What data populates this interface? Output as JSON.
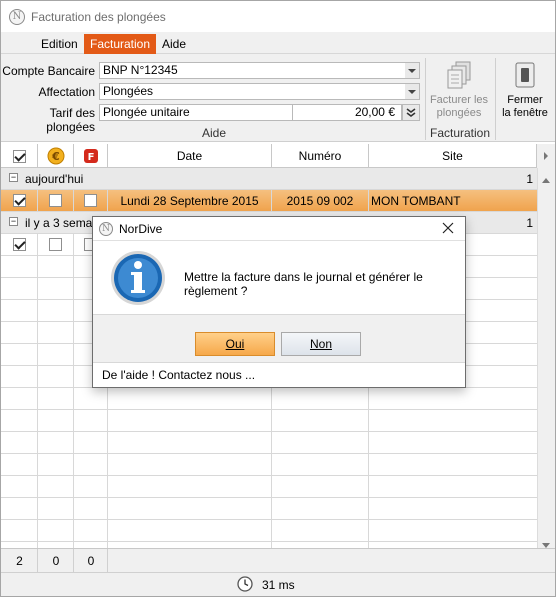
{
  "window": {
    "title": "Facturation des plongées"
  },
  "ribbon_tabs": [
    "Edition",
    "Facturation",
    "Aide"
  ],
  "ribbon": {
    "compte_label": "Compte Bancaire",
    "compte_value": "BNP N°12345",
    "affectation_label": "Affectation",
    "affectation_value": "Plongées",
    "tarif_label": "Tarif des plongées",
    "tarif_value": "Plongée unitaire",
    "tarif_amount": "20,00 €",
    "group_aide": "Aide",
    "group_facturation": "Facturation",
    "facturer_line1": "Facturer les",
    "facturer_line2": "plongées",
    "fermer_line1": "Fermer",
    "fermer_line2": "la fenêtre"
  },
  "grid": {
    "columns": {
      "date": "Date",
      "numero": "Numéro",
      "site": "Site"
    },
    "groups": [
      {
        "label": "aujourd'hui",
        "count": "1"
      },
      {
        "label": "il y a 3 semai",
        "count": "1"
      }
    ],
    "row1": {
      "date": "Lundi 28 Septembre 2015",
      "numero": "2015 09 002",
      "site": "MON TOMBANT"
    },
    "footer": {
      "c1": "2",
      "c2": "0",
      "c3": "0"
    }
  },
  "status": {
    "timing": "31 ms"
  },
  "dialog": {
    "title": "NorDive",
    "message": "Mettre la facture dans le journal et générer le règlement ?",
    "yes": "Oui",
    "no": "Non",
    "help": "De l'aide ! Contactez nous ..."
  },
  "colors": {
    "accent": "#e35a17",
    "selected_row": "#f0a34d",
    "info_blue": "#1a67b3"
  }
}
